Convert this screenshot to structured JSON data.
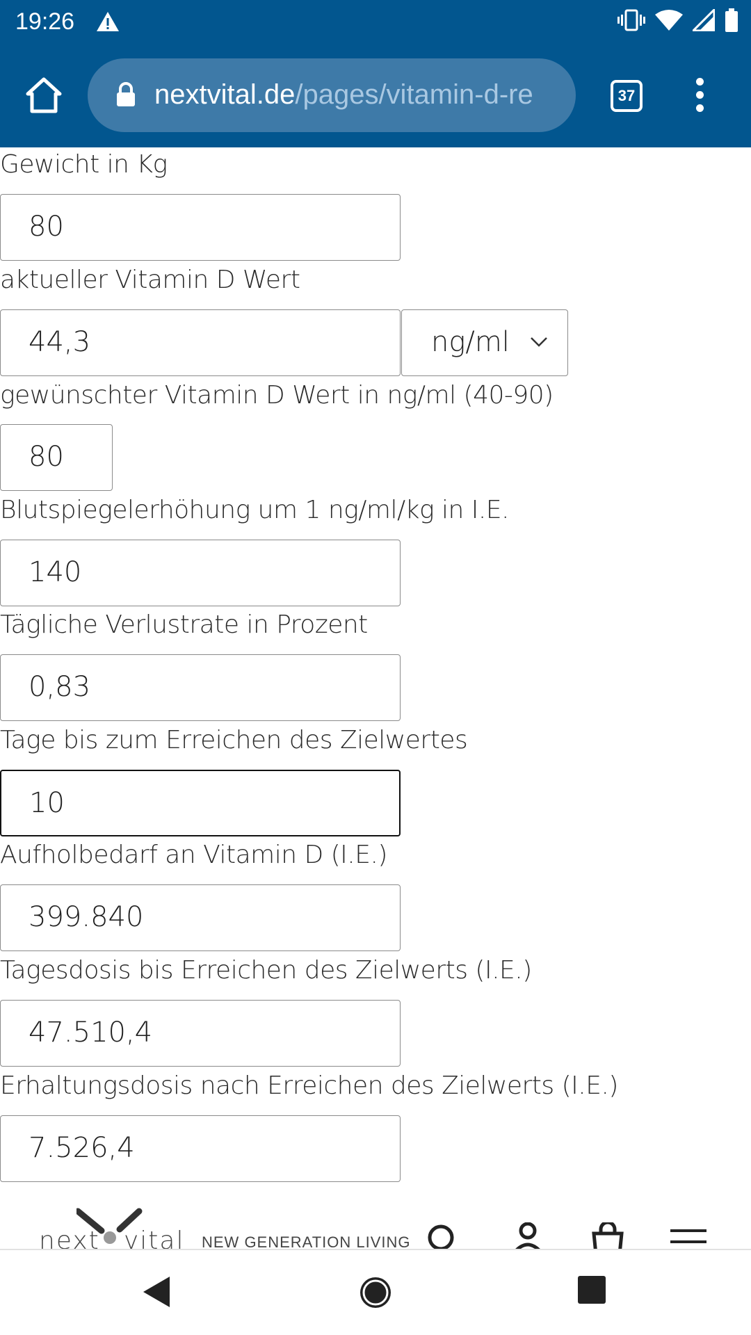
{
  "status_bar": {
    "time": "19:26",
    "icons": [
      "warning-icon",
      "vibrate-icon",
      "wifi-icon",
      "signal-icon",
      "battery-icon"
    ]
  },
  "browser": {
    "url_host": "nextvital.de",
    "url_path": "/pages/vitamin-d-re",
    "tab_count": "37",
    "toolbar_color": "#02568f"
  },
  "form": {
    "fields": [
      {
        "label": "Gewicht in Kg",
        "value": "80"
      },
      {
        "label": "aktueller Vitamin D Wert",
        "value": "44,3",
        "unit": "ng/ml"
      },
      {
        "label": "gewünschter Vitamin D Wert in ng/ml (40-90)",
        "value": "80"
      },
      {
        "label": "Blutspiegelerhöhung um 1 ng/ml/kg in I.E.",
        "value": "140"
      },
      {
        "label": "Tägliche Verlustrate in Prozent",
        "value": "0,83"
      },
      {
        "label": "Tage bis zum Erreichen des Zielwertes",
        "value": "10"
      },
      {
        "label": "Aufholbedarf an Vitamin D (I.E.)",
        "value": "399.840"
      },
      {
        "label": "Tagesdosis bis Erreichen des Zielwerts (I.E.)",
        "value": "47.510,4"
      },
      {
        "label": "Erhaltungsdosis nach Erreichen des Zielwerts (I.E.)",
        "value": "7.526,4"
      }
    ]
  },
  "site_header": {
    "logo_left": "next",
    "logo_right": "vital",
    "tagline": "NEW GENERATION LIVING",
    "icons": [
      "search-icon",
      "account-icon",
      "cart-icon",
      "hamburger-icon"
    ]
  },
  "nav_bar": {
    "icons": [
      "back-icon",
      "home-icon",
      "recents-icon"
    ]
  }
}
